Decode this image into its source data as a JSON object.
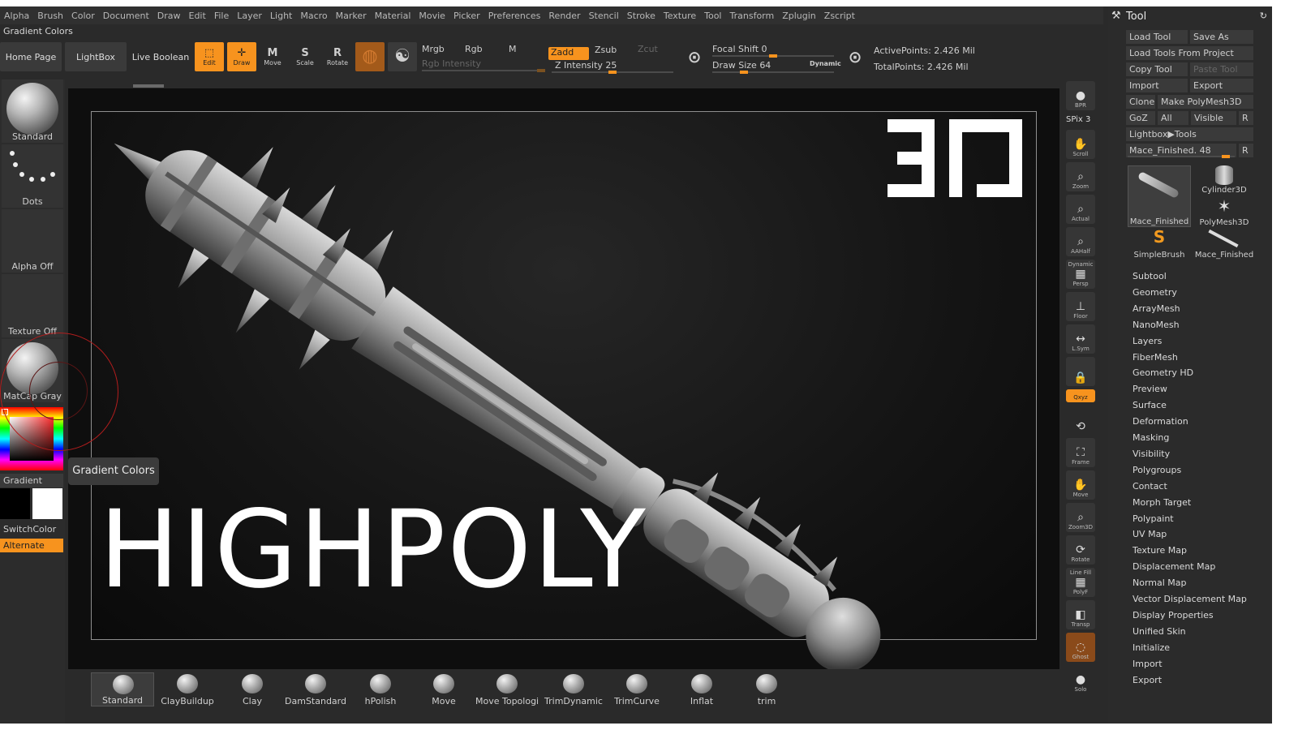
{
  "menu": [
    "Alpha",
    "Brush",
    "Color",
    "Document",
    "Draw",
    "Edit",
    "File",
    "Layer",
    "Light",
    "Macro",
    "Marker",
    "Material",
    "Movie",
    "Picker",
    "Preferences",
    "Render",
    "Stencil",
    "Stroke",
    "Texture",
    "Tool",
    "Transform",
    "Zplugin",
    "Zscript"
  ],
  "title_line": "Gradient Colors",
  "toolbar": {
    "home_page": "Home Page",
    "lightbox": "LightBox",
    "live_boolean": "Live Boolean",
    "edit": "Edit",
    "draw": "Draw",
    "move": "Move",
    "scale": "Scale",
    "rotate": "Rotate",
    "mrgb": "Mrgb",
    "rgb": "Rgb",
    "m": "M",
    "rgb_intensity": "Rgb Intensity",
    "zadd": "Zadd",
    "zsub": "Zsub",
    "zcut": "Zcut",
    "z_intensity_label": "Z Intensity",
    "z_intensity": "25",
    "focal_shift_label": "Focal Shift",
    "focal_shift": "0",
    "draw_size_label": "Draw Size",
    "draw_size": "64",
    "dynamic": "Dynamic",
    "active_points": "ActivePoints: 2.426 Mil",
    "total_points": "TotalPoints: 2.426 Mil"
  },
  "left_shelf": {
    "brush": "Standard",
    "stroke": "Dots",
    "alpha": "Alpha Off",
    "texture": "Texture Off",
    "material": "MatCap Gray",
    "gradient": "Gradient",
    "switch_color": "SwitchColor",
    "alternate": "Alternate",
    "primary_color": "#000000",
    "secondary_color": "#ffffff"
  },
  "viewport": {
    "headline": "HIGHPOLY",
    "tooltip": "Gradient Colors"
  },
  "brushes": [
    {
      "label": "Standard",
      "active": true
    },
    {
      "label": "ClayBuildup"
    },
    {
      "label": "Clay"
    },
    {
      "label": "DamStandard"
    },
    {
      "label": "hPolish"
    },
    {
      "label": "Move"
    },
    {
      "label": "Move Topologica"
    },
    {
      "label": "TrimDynamic"
    },
    {
      "label": "TrimCurve"
    },
    {
      "label": "Inflat"
    },
    {
      "label": "trim"
    }
  ],
  "right_shelf": {
    "bpr": "BPR",
    "spix": "SPix 3",
    "scroll": "Scroll",
    "zoom": "Zoom",
    "actual": "Actual",
    "aahalf": "AAHalf",
    "dynamic": "Dynamic",
    "persp": "Persp",
    "floor": "Floor",
    "lsym": "L.Sym",
    "xyz": "Qxyz",
    "frame": "Frame",
    "move": "Move",
    "zoom3d": "Zoom3D",
    "rotate": "Rotate",
    "line_fill": "Line Fill",
    "polyf": "PolyF",
    "transp": "Transp",
    "ghost": "Ghost",
    "solo": "Solo"
  },
  "tool_palette": {
    "title": "Tool",
    "load_tool": "Load Tool",
    "save_as": "Save As",
    "load_from_project": "Load Tools From Project",
    "copy_tool": "Copy Tool",
    "paste_tool": "Paste Tool",
    "import": "Import",
    "export": "Export",
    "clone": "Clone",
    "make_polymesh": "Make PolyMesh3D",
    "goz": "GoZ",
    "all": "All",
    "visible": "Visible",
    "r": "R",
    "lightbox_tools": "Lightbox▶Tools",
    "current_tool": "Mace_Finished.",
    "current_value": "48",
    "thumbs": [
      "Mace_Finished",
      "Cylinder3D",
      "PolyMesh3D",
      "SimpleBrush",
      "Mace_Finished"
    ],
    "subpalettes": [
      "Subtool",
      "Geometry",
      "ArrayMesh",
      "NanoMesh",
      "Layers",
      "FiberMesh",
      "Geometry HD",
      "Preview",
      "Surface",
      "Deformation",
      "Masking",
      "Visibility",
      "Polygroups",
      "Contact",
      "Morph Target",
      "Polypaint",
      "UV Map",
      "Texture Map",
      "Displacement Map",
      "Normal Map",
      "Vector Displacement Map",
      "Display Properties",
      "Unified Skin",
      "Initialize",
      "Import",
      "Export"
    ]
  },
  "colors": {
    "accent": "#f7931e",
    "background": "#2a2a2a",
    "viewport": "#0e0e0e"
  }
}
